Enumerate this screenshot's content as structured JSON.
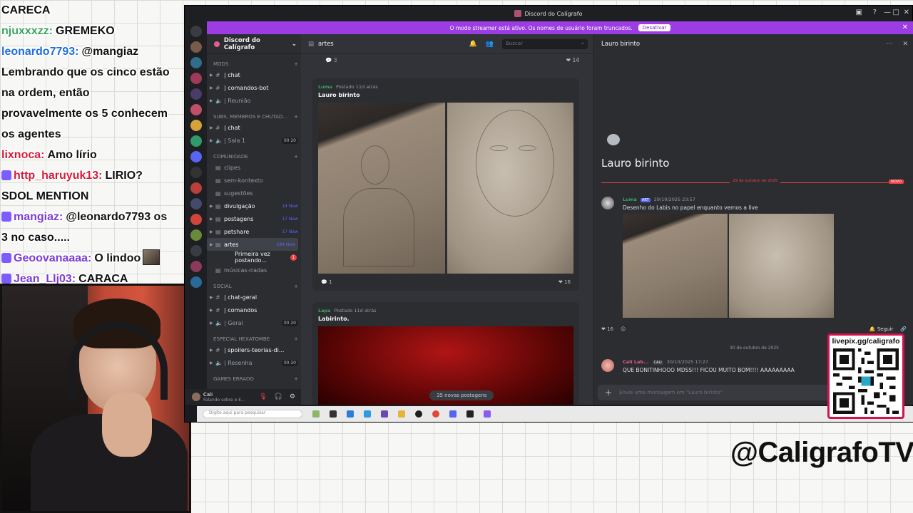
{
  "stream_chat": [
    {
      "user": "CARECA",
      "color": "#111111",
      "text": ""
    },
    {
      "user": "njuxxxzz:",
      "color": "#3ba55d",
      "text": "GREMEKO"
    },
    {
      "user": "leonardo7793:",
      "color": "#1e6fd9",
      "text": "@mangiaz"
    },
    {
      "user": "",
      "color": "#111111",
      "text": "Lembrando que os cinco estão"
    },
    {
      "user": "",
      "color": "#111111",
      "text": "na ordem, então"
    },
    {
      "user": "",
      "color": "#111111",
      "text": "provavelmente os 5 conhecem"
    },
    {
      "user": "",
      "color": "#111111",
      "text": "os agentes"
    },
    {
      "user": "lixnoca:",
      "color": "#d81b3a",
      "text": "Amo lírio"
    },
    {
      "user": "http_haruyuk13:",
      "color": "#d81b3a",
      "text": "LIRIO?",
      "badge": true
    },
    {
      "user": "",
      "color": "#111111",
      "text": "SDOL MENTION"
    },
    {
      "user": "mangiaz:",
      "color": "#7c3bd9",
      "text": "@leonardo7793 os",
      "badge": true
    },
    {
      "user": "",
      "color": "#111111",
      "text": "3 no caso....."
    },
    {
      "user": "Geoovanaaaa:",
      "color": "#7c3bd9",
      "text": "O lindoo",
      "badge": true,
      "emote": true
    },
    {
      "user": "Jean_Llj03:",
      "color": "#7c3bd9",
      "text": "CARACA",
      "badge": true
    }
  ],
  "window": {
    "title": "Discord do Calígrafo"
  },
  "banner": {
    "text": "O modo streamer está ativo. Os nomes de usuário foram truncados.",
    "button": "Desativar"
  },
  "guild": {
    "name": "Discord do Calígrafo"
  },
  "channels": [
    {
      "type": "cat",
      "label": "MODS"
    },
    {
      "type": "ch",
      "label": "| chat",
      "icon": "#",
      "sub": "chat-icon",
      "unread": true,
      "arrow": true
    },
    {
      "type": "ch",
      "label": "| comandos-bot",
      "icon": "#",
      "sub": "gear",
      "unread": true,
      "arrow": true
    },
    {
      "type": "ch",
      "label": "| Reunião",
      "icon": "🔈",
      "sub": "",
      "arrow": true
    },
    {
      "type": "cat",
      "label": "SUBS, MEMBROS E CHUTAD..."
    },
    {
      "type": "ch",
      "label": "| chat",
      "icon": "#",
      "sub": "chat-icon",
      "unread": true,
      "arrow": true
    },
    {
      "type": "ch",
      "label": "| Sala 1",
      "icon": "🔈",
      "cnt": "00  20",
      "arrow": true
    },
    {
      "type": "cat",
      "label": "COMUNIDADE"
    },
    {
      "type": "ch",
      "label": "clipes",
      "icon": "▤"
    },
    {
      "type": "ch",
      "label": "sem-kontexto",
      "icon": "▤"
    },
    {
      "type": "ch",
      "label": "sugestões",
      "icon": "▤"
    },
    {
      "type": "ch",
      "label": "divulgação",
      "icon": "▤",
      "unread": true,
      "arrow": true,
      "new": "14 New"
    },
    {
      "type": "ch",
      "label": "postagens",
      "icon": "▤",
      "unread": true,
      "arrow": true,
      "new": "17 New"
    },
    {
      "type": "ch",
      "label": "petshare",
      "icon": "▤",
      "unread": true,
      "arrow": true,
      "new": "17 New"
    },
    {
      "type": "ch",
      "label": "artes",
      "icon": "▤",
      "unread": true,
      "arrow": true,
      "new": "184 New",
      "active": true
    },
    {
      "type": "ch",
      "label": "Primeira vez postando...",
      "icon": "",
      "unread": true,
      "red": "1",
      "indent": true
    },
    {
      "type": "ch",
      "label": "músicas-iradas",
      "icon": "▤"
    },
    {
      "type": "cat",
      "label": "SOCIAL"
    },
    {
      "type": "ch",
      "label": "| chat-geral",
      "icon": "#",
      "unread": true,
      "arrow": true
    },
    {
      "type": "ch",
      "label": "| comandos",
      "icon": "#",
      "unread": true,
      "arrow": true
    },
    {
      "type": "ch",
      "label": "| Geral",
      "icon": "🔈",
      "cnt": "00  20",
      "arrow": true
    },
    {
      "type": "cat",
      "label": "ESPECIAL HEXATOMBE"
    },
    {
      "type": "ch",
      "label": "| spoilers-teorias-di...",
      "icon": "#",
      "unread": true,
      "arrow": true
    },
    {
      "type": "ch",
      "label": "| Resenha",
      "icon": "🔈",
      "cnt": "00  20",
      "arrow": true
    },
    {
      "type": "cat",
      "label": "GAMES ERRADO"
    }
  ],
  "user_panel": {
    "name": "Cali",
    "status": "Falando sobre o E..."
  },
  "forum": {
    "channel": "artes",
    "search_placeholder": "Buscar",
    "frag_count": "3",
    "frag_react": "14",
    "posts": [
      {
        "author": "Luma",
        "meta": "Postado 11d atrás",
        "title": "Lauro birinto",
        "comments": "1",
        "reacts": "16"
      },
      {
        "author": "Lapa",
        "meta": "Postado 11d atrás",
        "title": "Labirinto."
      }
    ],
    "new_posts": "35 novas postagens"
  },
  "thread": {
    "title": "Lauro birinto",
    "divider": "29 de outubro de 2025",
    "new_badge": "NOVO",
    "msg1": {
      "author": "Luma",
      "tag": "ART",
      "time": "29/10/2025 23:57",
      "text": "Desenho do Labis no papel enquanto vemos a live"
    },
    "reacts": "16",
    "follow": "Seguir",
    "divider2": "30 de outubro de 2025",
    "msg2": {
      "author": "Calí Lab...",
      "tag": "CALI",
      "time": "30/10/2025 17:27",
      "text": "QUE BONITINHOOO MDSS!!! FICOU MUITO BOM!!!! AAAAAAAAA"
    },
    "input_placeholder": "Envie uma mensagem em \"Lauro birinto\""
  },
  "taskbar": {
    "search": "Digite aqui para pesquisar"
  },
  "qr": {
    "label": "livepix.gg/caligrafo"
  },
  "handle": "@CaligrafoTV",
  "colors": {
    "blurple": "#5865f2",
    "streamer_purple": "#9b3de2",
    "accent_red": "#f23f43",
    "qr_border": "#d3124d"
  }
}
